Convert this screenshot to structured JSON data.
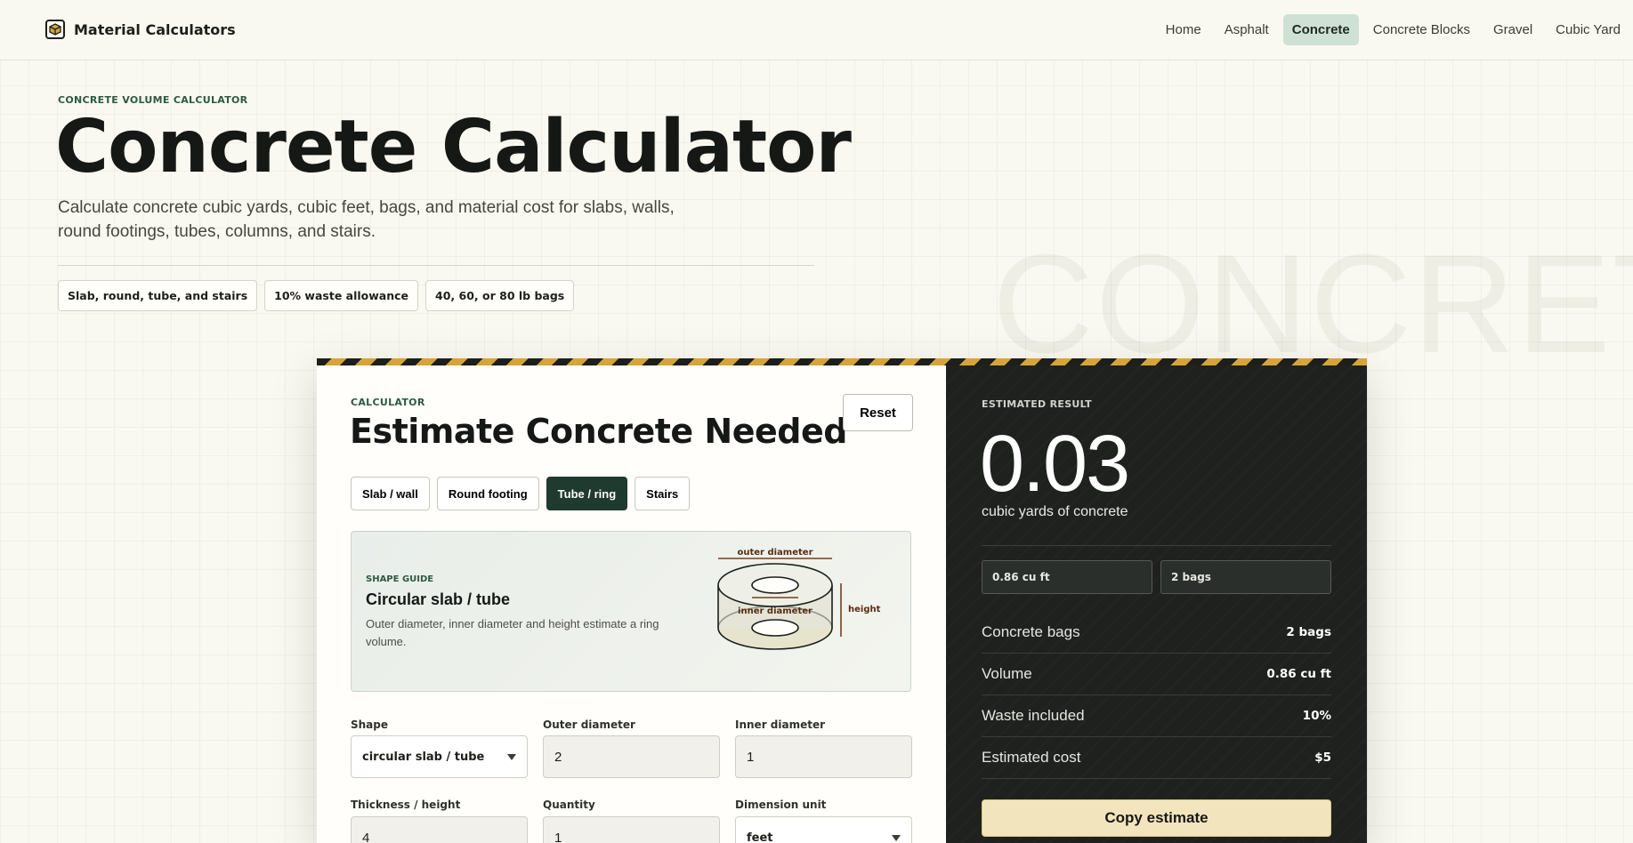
{
  "nav": {
    "brand": "Material Calculators",
    "links": [
      "Home",
      "Asphalt",
      "Concrete",
      "Concrete Blocks",
      "Gravel",
      "Cubic Yard"
    ],
    "active": "Concrete"
  },
  "hero": {
    "eyebrow": "CONCRETE VOLUME CALCULATOR",
    "title": "Concrete Calculator",
    "subtitle": "Calculate concrete cubic yards, cubic feet, bags, and material cost for slabs, walls, round footings, tubes, columns, and stairs.",
    "chips": [
      "Slab, round, tube, and stairs",
      "10% waste allowance",
      "40, 60, or 80 lb bags"
    ],
    "watermark": "CONCRETE"
  },
  "calculator": {
    "eyebrow": "CALCULATOR",
    "title": "Estimate Concrete Needed",
    "reset_label": "Reset",
    "tabs": [
      "Slab / wall",
      "Round footing",
      "Tube / ring",
      "Stairs"
    ],
    "active_tab": "Tube / ring",
    "guide": {
      "eyebrow": "SHAPE GUIDE",
      "title": "Circular slab / tube",
      "description": "Outer diameter, inner diameter and height estimate a ring volume.",
      "label_outer": "outer diameter",
      "label_inner": "inner diameter",
      "label_height": "height"
    },
    "fields": {
      "shape": {
        "label": "Shape",
        "value": "circular slab / tube"
      },
      "outer_diameter": {
        "label": "Outer diameter",
        "value": "2"
      },
      "inner_diameter": {
        "label": "Inner diameter",
        "value": "1"
      },
      "thickness": {
        "label": "Thickness / height",
        "value": "4"
      },
      "quantity": {
        "label": "Quantity",
        "value": "1"
      },
      "dimension_unit": {
        "label": "Dimension unit",
        "value": "feet"
      }
    }
  },
  "result": {
    "eyebrow": "ESTIMATED RESULT",
    "value": "0.03",
    "unit": "cubic yards of concrete",
    "chips": [
      "0.86 cu ft",
      "2 bags"
    ],
    "rows": [
      {
        "label": "Concrete bags",
        "value": "2 bags"
      },
      {
        "label": "Volume",
        "value": "0.86 cu ft"
      },
      {
        "label": "Waste included",
        "value": "10%"
      },
      {
        "label": "Estimated cost",
        "value": "$5"
      }
    ],
    "copy_label": "Copy estimate"
  },
  "colors": {
    "accent_green": "#1f3a2e",
    "hazard_yellow": "#d6a43a",
    "panel_dark": "#1e211e",
    "button_cream": "#f2e5bd"
  }
}
